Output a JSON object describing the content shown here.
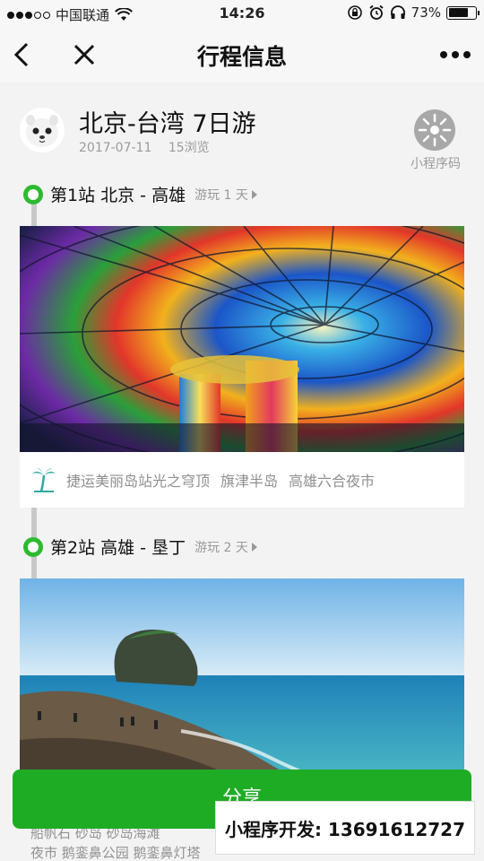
{
  "status_bar": {
    "carrier": "中国联通",
    "time": "14:26",
    "battery_percent": "73%",
    "battery_level": 0.73
  },
  "nav": {
    "title": "行程信息"
  },
  "trip": {
    "title": "北京-台湾 7日游",
    "date": "2017-07-11",
    "views": "15浏览",
    "qr_label": "小程序码"
  },
  "stations": [
    {
      "name": "第1站 北京 - 高雄",
      "play": "游玩 1 天",
      "spots": [
        "捷运美丽岛站光之穹顶",
        "旗津半岛",
        "高雄六合夜市"
      ]
    },
    {
      "name": "第2站 高雄 - 垦丁",
      "play": "游玩 2 天",
      "spots_partial_line1": "船帆石  砂岛  砂岛海滩",
      "spots_partial_line2": "夜市  鹅銮鼻公园  鹅銮鼻灯塔"
    }
  ],
  "share_label": "分享",
  "watermark": "小程序开发: 13691612727",
  "colors": {
    "accent_green": "#2dba30",
    "share_green": "#1fac25"
  }
}
